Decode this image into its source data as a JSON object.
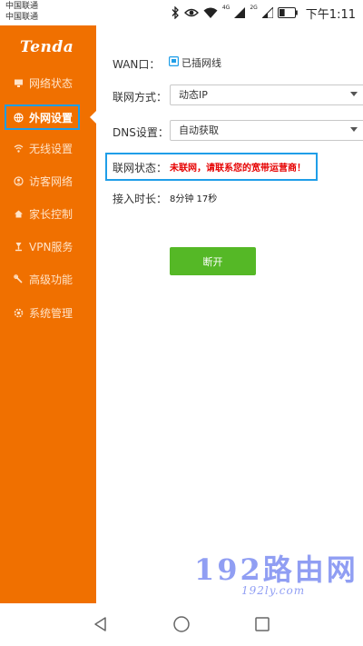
{
  "status_bar": {
    "carrier_1": "中国联通",
    "carrier_2": "中国联通",
    "net_1": "4G",
    "net_2": "2G",
    "battery_level": 0.35,
    "time": "下午1:11"
  },
  "sidebar": {
    "logo": "Tenda",
    "items": [
      {
        "label": "网络状态",
        "icon": "monitor-icon"
      },
      {
        "label": "外网设置",
        "icon": "globe-icon",
        "active": true
      },
      {
        "label": "无线设置",
        "icon": "wifi-icon"
      },
      {
        "label": "访客网络",
        "icon": "guest-icon"
      },
      {
        "label": "家长控制",
        "icon": "home-icon"
      },
      {
        "label": "VPN服务",
        "icon": "vpn-icon"
      },
      {
        "label": "高级功能",
        "icon": "wrench-icon"
      },
      {
        "label": "系统管理",
        "icon": "gear-icon"
      }
    ]
  },
  "main": {
    "wan_label": "WAN口：",
    "wan_status": "已插网线",
    "connection_type_label": "联网方式：",
    "connection_type_value": "动态IP",
    "dns_label": "DNS设置：",
    "dns_value": "自动获取",
    "status_label": "联网状态：",
    "status_value": "未联网，请联系您的宽带运营商！",
    "uptime_label": "接入时长：",
    "uptime_value": "8分钟 17秒",
    "disconnect_button": "断开"
  },
  "watermark": {
    "text": "192路由网",
    "url": "192ly.com"
  },
  "colors": {
    "sidebar": "#f07000",
    "highlight": "#1f9ee8",
    "error": "#e60000",
    "button": "#55b826"
  }
}
